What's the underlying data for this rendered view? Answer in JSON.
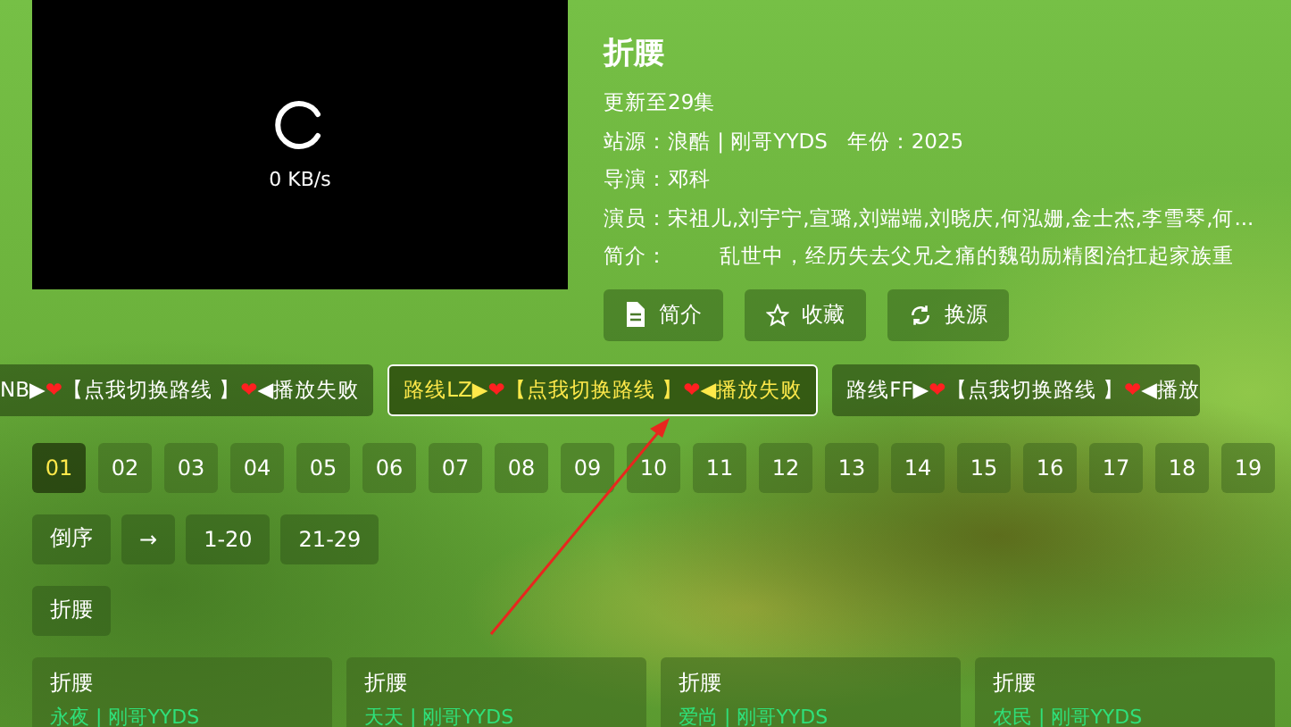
{
  "player": {
    "speed": "0 KB/s",
    "loading": true
  },
  "title": "折腰",
  "info": [
    "更新至29集",
    "站源：浪酷 | 刚哥YYDS   年份：2025",
    "导演：邓科",
    "演员：宋祖儿,刘宇宁,宣璐,刘端端,刘晓庆,何泓姗,金士杰,李雪琴,何...",
    "简介：        乱世中，经历失去父兄之痛的魏劭励精图治扛起家族重"
  ],
  "actions": [
    {
      "label": "简介"
    },
    {
      "label": "收藏"
    },
    {
      "label": "换源"
    }
  ],
  "routes": [
    {
      "selected": false,
      "parts": [
        {
          "text": "NB▶",
          "kind": "text"
        },
        {
          "text": "❤",
          "kind": "heart"
        },
        {
          "text": "【点我切换路线 】",
          "kind": "text"
        },
        {
          "text": "❤",
          "kind": "heart"
        },
        {
          "text": "◀播放失败",
          "kind": "text"
        }
      ]
    },
    {
      "selected": true,
      "parts": [
        {
          "text": "路线LZ▶",
          "kind": "text"
        },
        {
          "text": "❤",
          "kind": "heart"
        },
        {
          "text": "【点我切换路线 】",
          "kind": "text"
        },
        {
          "text": "❤",
          "kind": "heart"
        },
        {
          "text": "◀播放失败",
          "kind": "text"
        }
      ]
    },
    {
      "selected": false,
      "parts": [
        {
          "text": "路线FF▶",
          "kind": "text"
        },
        {
          "text": "❤",
          "kind": "heart"
        },
        {
          "text": "【点我切换路线 】",
          "kind": "text"
        },
        {
          "text": "❤",
          "kind": "heart"
        },
        {
          "text": "◀播放",
          "kind": "text"
        }
      ]
    }
  ],
  "episodes": [
    {
      "label": "01",
      "selected": true
    },
    {
      "label": "02",
      "selected": false
    },
    {
      "label": "03",
      "selected": false
    },
    {
      "label": "04",
      "selected": false
    },
    {
      "label": "05",
      "selected": false
    },
    {
      "label": "06",
      "selected": false
    },
    {
      "label": "07",
      "selected": false
    },
    {
      "label": "08",
      "selected": false
    },
    {
      "label": "09",
      "selected": false
    },
    {
      "label": "10",
      "selected": false
    },
    {
      "label": "11",
      "selected": false
    },
    {
      "label": "12",
      "selected": false
    },
    {
      "label": "13",
      "selected": false
    },
    {
      "label": "14",
      "selected": false
    },
    {
      "label": "15",
      "selected": false
    },
    {
      "label": "16",
      "selected": false
    },
    {
      "label": "17",
      "selected": false
    },
    {
      "label": "18",
      "selected": false
    },
    {
      "label": "19",
      "selected": false
    }
  ],
  "sort_controls": [
    "倒序",
    "→",
    "1-20",
    "21-29"
  ],
  "season_tags": [
    "折腰"
  ],
  "related": [
    {
      "title": "折腰",
      "source": "永夜 | 刚哥YYDS"
    },
    {
      "title": "折腰",
      "source": "天天 | 刚哥YYDS"
    },
    {
      "title": "折腰",
      "source": "爱尚 | 刚哥YYDS"
    },
    {
      "title": "折腰",
      "source": "农民 | 刚哥YYDS"
    }
  ]
}
